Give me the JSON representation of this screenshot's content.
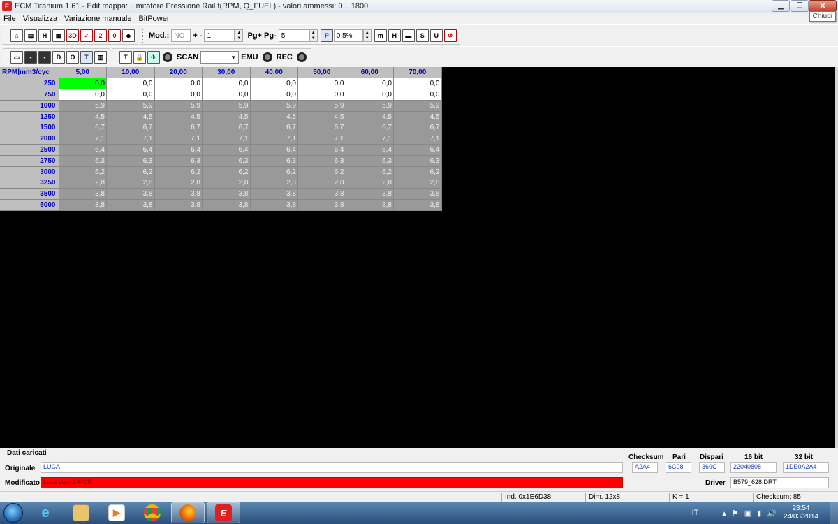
{
  "window": {
    "title": "ECM Titanium 1.61 - Edit mappa: Limitatore Pressione Rail f(RPM, Q_FUEL) - valori ammessi: 0 .. 1800",
    "tooltip": "Chiudi"
  },
  "menu": [
    "File",
    "Visualizza",
    "Variazione manuale",
    "BitPower"
  ],
  "toolbar1": {
    "mod_label": "Mod.:",
    "mod_value": "NO",
    "plusminus_label": "+ -",
    "plusminus_value": "1",
    "pg_label": "Pg+ Pg-",
    "pg_value": "5",
    "p_label": "P",
    "percent_value": "0,5%"
  },
  "toolbar2": {
    "scan_label": "SCAN",
    "emu_label": "EMU",
    "rec_label": "REC"
  },
  "map": {
    "corner": "RPM|mm3/cyc",
    "columns": [
      "5,00",
      "10,00",
      "20,00",
      "30,00",
      "40,00",
      "50,00",
      "60,00",
      "70,00"
    ],
    "rows": [
      {
        "rpm": "250",
        "values": [
          "0,0",
          "0,0",
          "0,0",
          "0,0",
          "0,0",
          "0,0",
          "0,0",
          "0,0"
        ]
      },
      {
        "rpm": "750",
        "values": [
          "0,0",
          "0,0",
          "0,0",
          "0,0",
          "0,0",
          "0,0",
          "0,0",
          "0,0"
        ]
      },
      {
        "rpm": "1000",
        "values": [
          "5,9",
          "5,9",
          "5,9",
          "5,9",
          "5,9",
          "5,9",
          "5,9",
          "5,9"
        ]
      },
      {
        "rpm": "1250",
        "values": [
          "4,5",
          "4,5",
          "4,5",
          "4,5",
          "4,5",
          "4,5",
          "4,5",
          "4,5"
        ]
      },
      {
        "rpm": "1500",
        "values": [
          "6,7",
          "6,7",
          "6,7",
          "6,7",
          "6,7",
          "6,7",
          "6,7",
          "6,7"
        ]
      },
      {
        "rpm": "2000",
        "values": [
          "7,1",
          "7,1",
          "7,1",
          "7,1",
          "7,1",
          "7,1",
          "7,1",
          "7,1"
        ]
      },
      {
        "rpm": "2500",
        "values": [
          "6,4",
          "6,4",
          "6,4",
          "6,4",
          "6,4",
          "6,4",
          "6,4",
          "6,4"
        ]
      },
      {
        "rpm": "2750",
        "values": [
          "6,3",
          "6,3",
          "6,3",
          "6,3",
          "6,3",
          "6,3",
          "6,3",
          "6,3"
        ]
      },
      {
        "rpm": "3000",
        "values": [
          "6,2",
          "6,2",
          "6,2",
          "6,2",
          "6,2",
          "6,2",
          "6,2",
          "6,2"
        ]
      },
      {
        "rpm": "3250",
        "values": [
          "2,8",
          "2,8",
          "2,8",
          "2,8",
          "2,8",
          "2,8",
          "2,8",
          "2,8"
        ]
      },
      {
        "rpm": "3500",
        "values": [
          "3,8",
          "3,8",
          "3,8",
          "3,8",
          "3,8",
          "3,8",
          "3,8",
          "3,8"
        ]
      },
      {
        "rpm": "5000",
        "values": [
          "3,8",
          "3,8",
          "3,8",
          "3,8",
          "3,8",
          "3,8",
          "3,8",
          "3,8"
        ]
      }
    ],
    "colors": {
      "selected": "#00ff00",
      "header_text": "#0000cc",
      "grey_cell": "#999999"
    }
  },
  "bottom": {
    "section_label": "Dati caricati",
    "originale_label": "Originale",
    "originale_value": "LUCA",
    "modificato_label": "Modificato",
    "modificato_value": "Luca step 1 MOD",
    "checksum_label": "Checksum",
    "pari_label": "Pari",
    "dispari_label": "Dispari",
    "bit16_label": "16 bit",
    "bit32_label": "32 bit",
    "checksum_value": "A2A4",
    "pari_value": "6C08",
    "dispari_value": "369C",
    "bit16_value": "22040808",
    "bit32_value": "1DE0A2A4",
    "driver_label": "Driver",
    "driver_value": "B579_628.DRT"
  },
  "status": {
    "ind": "Ind. 0x1E6D38",
    "dim": "Dim. 12x8",
    "k": "K = 1",
    "checksum": "Checksum: 85"
  },
  "taskbar": {
    "lang": "IT",
    "time": "23:54",
    "date": "24/03/2014"
  }
}
